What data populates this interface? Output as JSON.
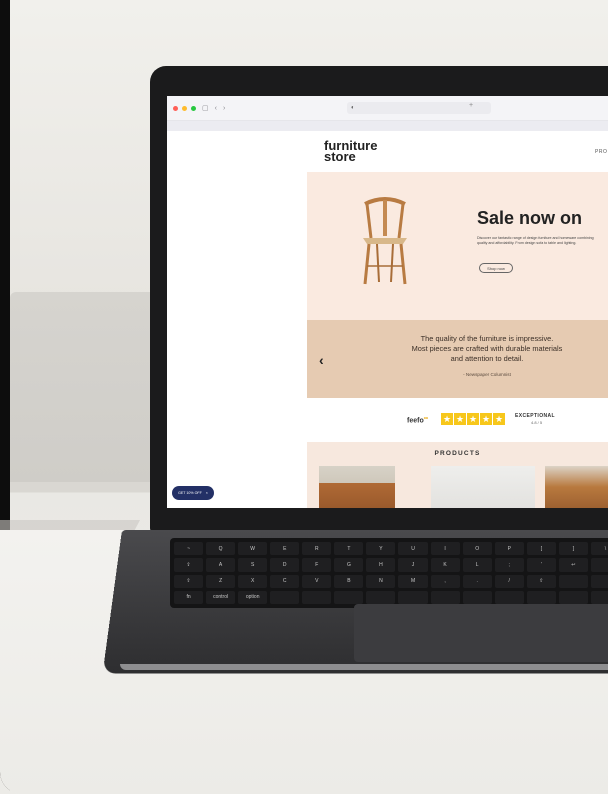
{
  "browser": {
    "address_icon": "shield-icon",
    "address_text": "◐",
    "new_tab": "+",
    "nav_back": "‹",
    "nav_forward": "›",
    "sidebar_icon": "▢",
    "traffic_colors": [
      "#ff5f57",
      "#febc2e",
      "#28c840"
    ]
  },
  "site": {
    "logo_line1": "furniture",
    "logo_line2": "store",
    "nav_products": "PRO",
    "hero": {
      "title": "Sale now on",
      "description": "Discover our fantastic range of design furniture and homeware combining quality and affordability. From design sofa to table and lighting.",
      "button": "Shop now"
    },
    "quote": {
      "line1": "The quality of the furniture is impressive.",
      "line2": "Most pieces are crafted with durable materials",
      "line3": "and attention to detail.",
      "author": "- Newspaper Columnist",
      "prev_arrow": "‹"
    },
    "reviews": {
      "brand": "feefo",
      "rating_label": "EXCEPTIONAL",
      "score": "4.8 / 5",
      "stars": 5
    },
    "products_title": "PRODUCTS",
    "promo_badge": "GET 10% OFF",
    "promo_close": "×"
  },
  "keyboard": {
    "row2": [
      "~",
      "Q",
      "W",
      "E",
      "R",
      "T",
      "Y",
      "U",
      "I",
      "O",
      "P",
      "[",
      "]",
      "\\"
    ],
    "row3": [
      "⇪",
      "A",
      "S",
      "D",
      "F",
      "G",
      "H",
      "J",
      "K",
      "L",
      ";",
      "'",
      "↩",
      ""
    ],
    "row4": [
      "⇧",
      "Z",
      "X",
      "C",
      "V",
      "B",
      "N",
      "M",
      ",",
      ".",
      "/",
      "⇧",
      "",
      ""
    ],
    "row5": [
      "fn",
      "control",
      "option",
      "",
      "",
      "",
      "",
      "",
      "",
      "",
      "",
      "",
      "",
      ""
    ]
  },
  "colors": {
    "hero_bg": "#faeae0",
    "quote_bg": "#e6cbb2",
    "products_bg": "#f7e8de",
    "star": "#f7c71b",
    "promo": "#233066"
  }
}
